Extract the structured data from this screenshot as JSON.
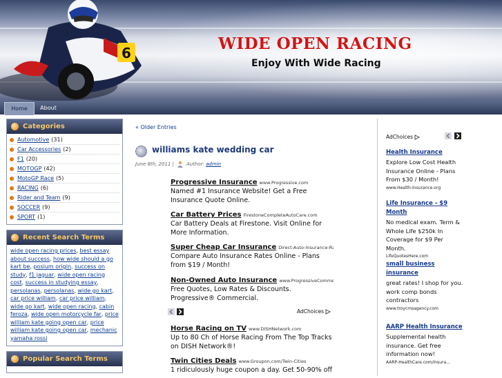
{
  "header": {
    "title": "WIDE OPEN RACING",
    "tagline": "Enjoy With Wide Racing",
    "rider_number": "6"
  },
  "nav": {
    "items": [
      {
        "label": "Home",
        "active": true
      },
      {
        "label": "About",
        "active": false
      }
    ]
  },
  "sidebar": {
    "categories": {
      "title": "Categories",
      "items": [
        {
          "label": "Automotive",
          "count": "(31)"
        },
        {
          "label": "Car Accessories",
          "count": "(2)"
        },
        {
          "label": "F1",
          "count": "(20)"
        },
        {
          "label": "MOTOGP",
          "count": "(42)"
        },
        {
          "label": "MotoGP Race",
          "count": "(5)"
        },
        {
          "label": "RACING",
          "count": "(6)"
        },
        {
          "label": "Rider and Team",
          "count": "(9)"
        },
        {
          "label": "SOCCER",
          "count": "(9)"
        },
        {
          "label": "SPORT",
          "count": "(1)"
        }
      ]
    },
    "recent_terms": {
      "title": "Recent Search Terms",
      "items": [
        "wide open racing prices",
        "best essay about success",
        "how wide should a go kart be",
        "posium origin",
        "success on study",
        "f1 jaguar",
        "wide open racing cost",
        "success in studying essay",
        "persolanas",
        "persolanas",
        "wide go kart",
        "car price william",
        "car price william",
        "wide go kart",
        "wide open racing",
        "cabin feroza",
        "wide open motorcycle far",
        "price william kate going open car",
        "price william kate going open car",
        "mechanic yamaha rossi"
      ]
    },
    "popular_terms": {
      "title": "Popular Search Terms"
    }
  },
  "main": {
    "older_entries": "« Older Entries",
    "post": {
      "title": "williams kate wedding car",
      "date": "June 8th, 2011 |",
      "author_label": "Author:",
      "author": "admin"
    },
    "ads": [
      {
        "title": "Progressive Insurance",
        "url": "www.Progressive.com",
        "body": "Named #1 Insurance Website! Get a Free Insurance Quote Online."
      },
      {
        "title": "Car Battery Prices",
        "url": "FirestoneCompleteAutoCare.com",
        "body": "Car Battery Deals at Firestone. Visit Online for More Information."
      },
      {
        "title": "Super Cheap Car Insurance",
        "url": "Direct-Auto-Insurance-Rat...",
        "body": "Compare Auto Insurance Rates Online - Plans from $19 / Month!"
      },
      {
        "title": "Non-Owned Auto Insurance",
        "url": "www.ProgressiveCommer...",
        "body": "Free Quotes, Low Rates & Discounts. Progressive® Commercial."
      },
      {
        "title": "Horse Racing on TV",
        "url": "www.DISHNetwork.com",
        "body": "Up to 80 Ch of Horse Racing From The Top Tracks on DISH Network®!"
      },
      {
        "title": "Twin Cities Deals",
        "url": "www.Groupon.com/Twin-Cities",
        "body": "1 ridiculously huge coupon a day. Get 50-90% off"
      }
    ],
    "adchoices": "AdChoices"
  },
  "right": {
    "adchoices": "AdChoices",
    "ads": [
      {
        "title": "Health Insurance",
        "body": "Explore Low Cost Health Insurance Online - Plans From $30 / Month!",
        "url": "www.Health-Insurance.org"
      },
      {
        "title": "Life Insurance - $9 Month",
        "body": "No medical exam. Term & Whole Life $250k In Coverage for $9 Per Month.",
        "url": "LifeQuotesHere.com"
      },
      {
        "title": "small business insurance",
        "body": "great rates! I shop for you. work comp bonds contractors",
        "url": "www.troycmsagency.com"
      },
      {
        "title": "AARP Health Insurance",
        "body": "Supplemental health insurance. Get free information now!",
        "url": "AARP-HealthCare.com/Insura..."
      }
    ]
  },
  "colors": {
    "title_red": "#d21414",
    "link_blue": "#0b3c8f",
    "widget_title_gold": "#f5c86a",
    "bullet_orange": "#e07a10"
  }
}
